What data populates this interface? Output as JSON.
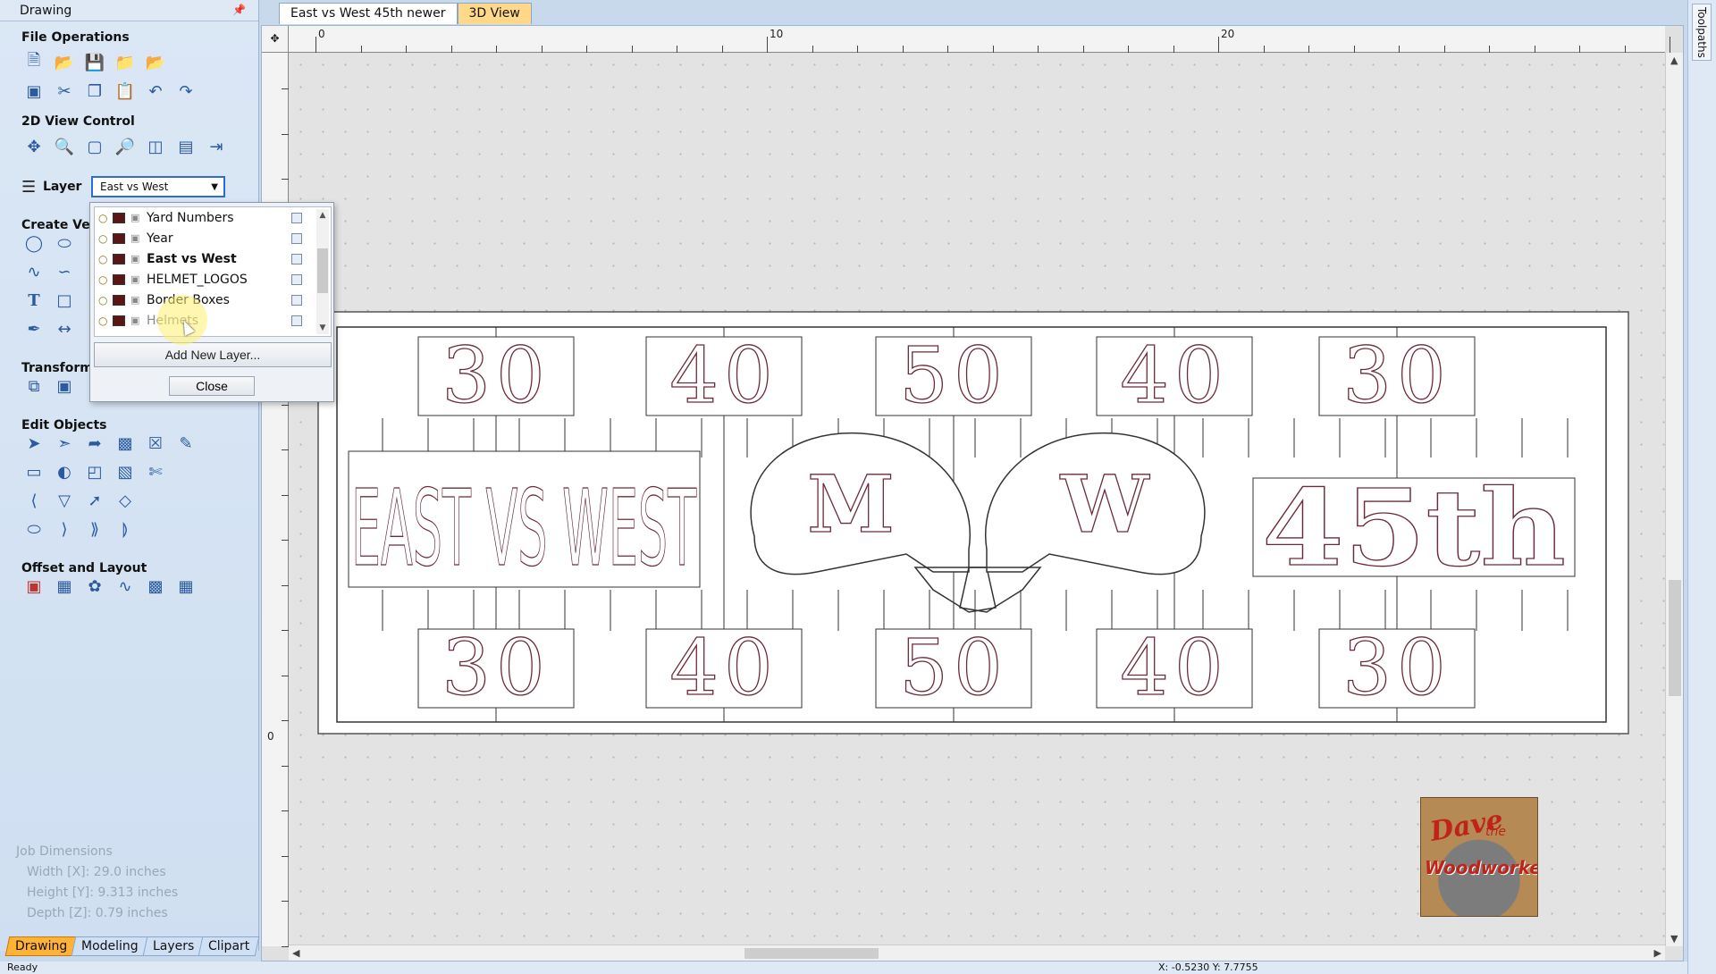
{
  "panel": {
    "title": "Drawing"
  },
  "sections": {
    "file_ops": "File Operations",
    "view_2d": "2D View Control",
    "create_vectors": "Create Vect",
    "transform": "Transform C",
    "edit_objects": "Edit Objects",
    "offset_layout": "Offset and Layout"
  },
  "layer": {
    "label": "Layer",
    "selected": "East vs West",
    "items": [
      {
        "name": "Yard Numbers",
        "style": "normal"
      },
      {
        "name": "Year",
        "style": "normal"
      },
      {
        "name": "East vs West",
        "style": "bold"
      },
      {
        "name": "HELMET_LOGOS",
        "style": "normal"
      },
      {
        "name": "Border Boxes",
        "style": "normal"
      },
      {
        "name": "Helmets",
        "style": "dim"
      }
    ],
    "add_button": "Add New Layer...",
    "close_button": "Close"
  },
  "job": {
    "title": "Job Dimensions",
    "width": "Width  [X]: 29.0 inches",
    "height": "Height [Y]: 9.313 inches",
    "depth": "Depth  [Z]: 0.79 inches"
  },
  "bottom_tabs": [
    "Drawing",
    "Modeling",
    "Layers",
    "Clipart"
  ],
  "doc_tabs": {
    "active": "East vs West 45th newer",
    "other": "3D View"
  },
  "ruler": {
    "h_labels": [
      "0",
      "10",
      "20"
    ],
    "v_label": "0"
  },
  "board": {
    "top_numbers": [
      "30",
      "40",
      "50",
      "40",
      "30"
    ],
    "bottom_numbers": [
      "30",
      "40",
      "50",
      "40",
      "30"
    ],
    "title_text": "EAST VS WEST",
    "year_text": "45th",
    "helmet_letters": [
      "M",
      "W"
    ]
  },
  "watermark": {
    "line1": "Dave",
    "line2": "the",
    "line3": "Woodworker"
  },
  "right_tab": "Toolpaths",
  "status": {
    "text": "Ready",
    "coords": "X: -0.5230 Y: 7.7755"
  },
  "colors": {
    "accent": "#ffb233",
    "layer_swatch": "#5b1515",
    "vector_color": "#6b2b3a"
  },
  "icons": {
    "file_ops_row1": [
      "new-file-icon",
      "open-icon",
      "save-icon",
      "open-folder-icon",
      "import-icon"
    ],
    "file_ops_row2": [
      "select-all-icon",
      "cut-icon",
      "copy-icon",
      "paste-icon",
      "undo-icon",
      "redo-icon"
    ],
    "view_2d": [
      "pan-icon",
      "zoom-icon",
      "zoom-box-icon",
      "zoom-extents-icon",
      "view-layers-icon",
      "view-grid-icon",
      "view-toggle-icon"
    ]
  }
}
